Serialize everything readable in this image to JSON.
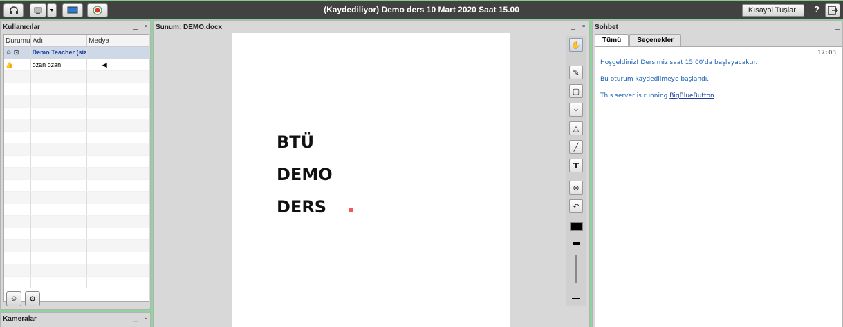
{
  "window": {
    "title": "(Kaydediliyor) Demo ders 10 Mart 2020 Saat 15.00",
    "shortcuts_label": "Kısayol Tuşları",
    "help_label": "?"
  },
  "users_panel": {
    "title": "Kullanıcılar",
    "minimize": "_",
    "maximize": "▫",
    "columns": [
      "Durumu",
      "Adı",
      "Medya"
    ],
    "rows": [
      {
        "status": "☺ ⊡",
        "name": "Demo Teacher (siz)",
        "media": ""
      },
      {
        "status": "👍",
        "name": "ozan ozan",
        "media": "◀"
      }
    ]
  },
  "cameras_panel": {
    "title": "Kameralar",
    "minimize": "_",
    "maximize": "▫"
  },
  "presentation": {
    "title": "Sunum: DEMO.docx",
    "minimize": "_",
    "maximize": "▫",
    "slide_lines": [
      "BTÜ",
      "DEMO",
      "DERS"
    ],
    "tools": [
      "hand-icon",
      "pencil-icon",
      "rectangle-icon",
      "circle-icon",
      "triangle-icon",
      "line-icon",
      "text-icon",
      "clear-icon",
      "undo-icon",
      "color-icon",
      "thickness-icon"
    ]
  },
  "chat_panel": {
    "title": "Sohbet",
    "minimize": "_",
    "tabs": [
      "Tümü",
      "Seçenekler"
    ],
    "time": "17:03",
    "messages": [
      "Hoşgeldiniz! Dersimiz saat 15.00'da başlayacaktır.",
      "Bu oturum kaydedilmeye başlandı.",
      "This server is running "
    ],
    "link_text": "BigBlueButton",
    "link_suffix": "."
  },
  "colors": {
    "topbar": "#424242",
    "accent_green": "#8fd49a",
    "chat_text": "#1a5fb4"
  }
}
